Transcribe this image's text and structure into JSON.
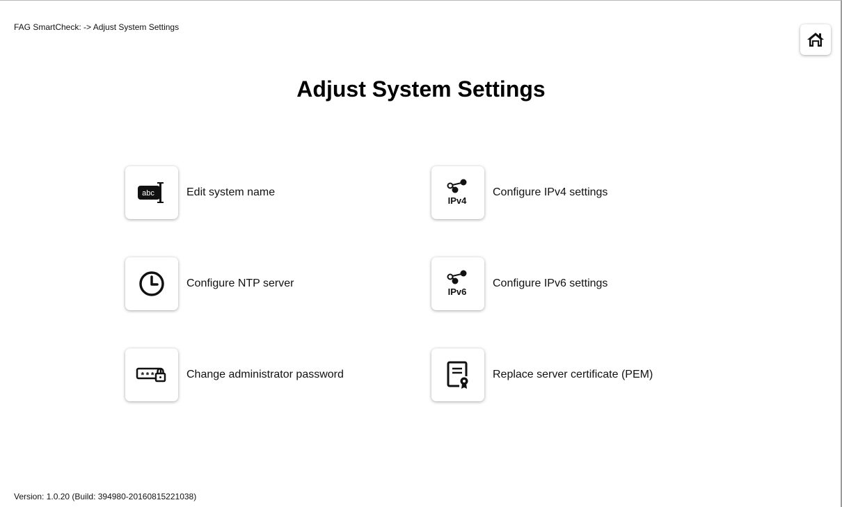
{
  "breadcrumb": "FAG SmartCheck: -> Adjust System Settings",
  "title": "Adjust System Settings",
  "items": [
    {
      "label": "Edit system name",
      "icon": "text-cursor-icon"
    },
    {
      "label": "Configure IPv4 settings",
      "icon": "ipv4-network-icon"
    },
    {
      "label": "Configure NTP server",
      "icon": "clock-icon"
    },
    {
      "label": "Configure IPv6 settings",
      "icon": "ipv6-network-icon"
    },
    {
      "label": "Change administrator password",
      "icon": "password-lock-icon"
    },
    {
      "label": "Replace server certificate (PEM)",
      "icon": "certificate-icon"
    }
  ],
  "icon_text": {
    "abc": "abc",
    "ipv4": "IPv4",
    "ipv6": "IPv6",
    "stars": "***"
  },
  "version": "Version: 1.0.20 (Build: 394980-20160815221038)",
  "home_icon": "home-icon",
  "colors": {
    "background": "#ffffff",
    "text": "#000000",
    "icon": "#111111"
  }
}
